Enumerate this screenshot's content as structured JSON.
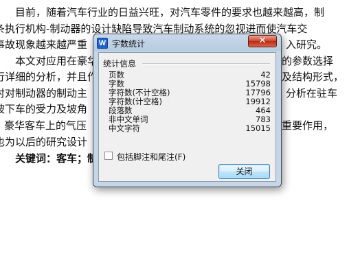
{
  "document": {
    "lines": [
      "目前，随着汽车行业的日益兴旺，对汽车零件的要求也越来越高，制",
      "条执行机构-制动器的设计缺陷导致汽车制动系统的忽视进而使汽车交",
      "事故现象越来越严重",
      "本文对应用在豪华",
      "行详细的分析，并且作",
      "对对制动器的制动主",
      "坡下车的受力及坡角",
      "豪华客车上的气压",
      "也为以后的研究设计",
      "关键词：客车；制"
    ],
    "right_fragments": [
      "入研究。",
      "的参数选择",
      "及结构形式，",
      "分析在驻车",
      "重要作用，"
    ],
    "keyword_label": "关键词："
  },
  "dialog": {
    "title": "字数统计",
    "app_icon": "W",
    "close_glyph": "✕",
    "group_title": "统计信息",
    "stats": [
      {
        "label": "页数",
        "value": "42"
      },
      {
        "label": "字数",
        "value": "15798"
      },
      {
        "label": "字符数(不计空格)",
        "value": "17796"
      },
      {
        "label": "字符数(计空格)",
        "value": "19912"
      },
      {
        "label": "段落数",
        "value": "464"
      },
      {
        "label": "非中文单词",
        "value": "783"
      },
      {
        "label": "中文字符",
        "value": "15015"
      }
    ],
    "checkbox_label": "包括脚注和尾注(F)",
    "checkbox_checked": false,
    "ok_label": "关闭"
  }
}
